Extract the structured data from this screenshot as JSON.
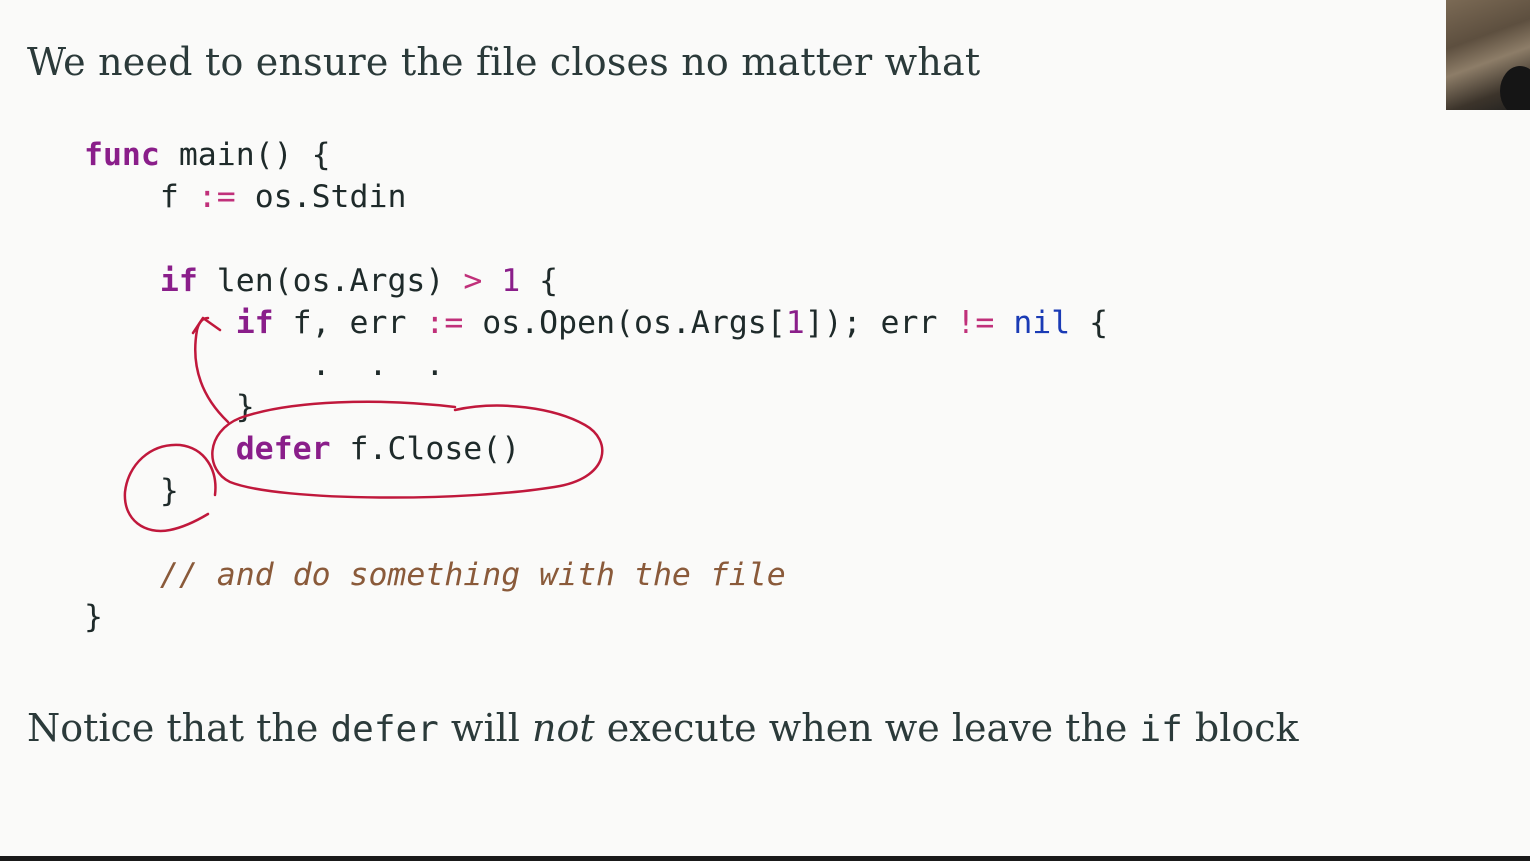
{
  "slide": {
    "heading": "We need to ensure the file closes no matter what",
    "code": {
      "line1": {
        "kw": "func",
        "rest": " main() {"
      },
      "line2": {
        "indent": "    ",
        "a": "f ",
        "op": ":=",
        "b": " os.Stdin"
      },
      "line4": {
        "indent": "    ",
        "kw": "if",
        "a": " len(os.Args) ",
        "op": ">",
        "sp": " ",
        "num": "1",
        "b": " {"
      },
      "line5": {
        "indent": "        ",
        "kw": "if",
        "a": " f, err ",
        "op": ":=",
        "b": " os.Open(os.Args[",
        "num": "1",
        "c": "]); err ",
        "op2": "!=",
        "sp": " ",
        "nil": "nil",
        "d": " {"
      },
      "line6": {
        "text": "            .  .  ."
      },
      "line7": {
        "text": "        }"
      },
      "line8": {
        "indent": "        ",
        "kw": "defer",
        "rest": " f.Close()"
      },
      "line9": {
        "text": "    }"
      },
      "line11": {
        "indent": "    ",
        "comment": "// and do something with the file"
      },
      "line12": {
        "text": "}"
      }
    },
    "notice": {
      "part1": "Notice that the ",
      "code1": "defer",
      "part2": " will ",
      "emphasis": "not",
      "part3": " execute when we leave the ",
      "code2": "if",
      "part4": " block"
    }
  },
  "colors": {
    "background": "#fafaf9",
    "text": "#2b3a3a",
    "keyword": "#8a1e8a",
    "operator": "#c0307a",
    "nil": "#1a3bb5",
    "comment": "#8a5a3a",
    "annotation": "#c0183c"
  }
}
